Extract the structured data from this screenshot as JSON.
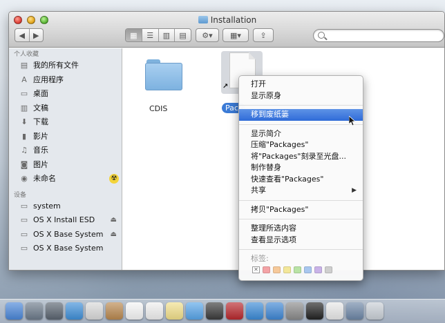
{
  "window": {
    "title": "Installation"
  },
  "sidebar": {
    "favorites_header": "个人收藏",
    "favorites": [
      {
        "label": "我的所有文件",
        "icon": "all-files-icon",
        "glyph": "▤"
      },
      {
        "label": "应用程序",
        "icon": "applications-icon",
        "glyph": "A"
      },
      {
        "label": "桌面",
        "icon": "desktop-icon",
        "glyph": "▭"
      },
      {
        "label": "文稿",
        "icon": "documents-icon",
        "glyph": "▥"
      },
      {
        "label": "下载",
        "icon": "downloads-icon",
        "glyph": "⬇"
      },
      {
        "label": "影片",
        "icon": "movies-icon",
        "glyph": "▮"
      },
      {
        "label": "音乐",
        "icon": "music-icon",
        "glyph": "♫"
      },
      {
        "label": "图片",
        "icon": "pictures-icon",
        "glyph": "◙"
      },
      {
        "label": "未命名",
        "icon": "radioactive-icon",
        "glyph": "☢"
      }
    ],
    "devices_header": "设备",
    "devices": [
      {
        "label": "system",
        "icon": "disk-icon",
        "glyph": "▭"
      },
      {
        "label": "OS X Install ESD",
        "icon": "disk-icon",
        "glyph": "▭"
      },
      {
        "label": "OS X Base System",
        "icon": "disk-icon",
        "glyph": "▭"
      },
      {
        "label": "OS X Base System",
        "icon": "disk-icon",
        "glyph": "▭"
      }
    ]
  },
  "content": {
    "folder_label": "CDIS",
    "selected_item_label": "Packages"
  },
  "context_menu": {
    "group1": [
      "打开",
      "显示原身"
    ],
    "highlighted": "移到废纸篓",
    "group2": [
      "显示简介",
      "压缩\"Packages\"",
      "将\"Packages\"刻录至光盘...",
      "制作替身",
      "快速查看\"Packages\""
    ],
    "share": "共享",
    "group3": [
      "拷贝\"Packages\""
    ],
    "group4": [
      "整理所选内容",
      "查看显示选项"
    ],
    "tags_label": "标签:",
    "tag_colors": [
      "#f4a3a6",
      "#f6c99a",
      "#f3e79a",
      "#b9e3a5",
      "#a8c7ef",
      "#c9b3e8",
      "#cfcfcf"
    ]
  },
  "dock": {
    "apps": [
      {
        "icon": "finder-icon",
        "color": "#4a86d8"
      },
      {
        "icon": "launchpad-icon",
        "color": "#6c7a8a"
      },
      {
        "icon": "mission-control-icon",
        "color": "#5a6470"
      },
      {
        "icon": "safari-icon",
        "color": "#3f8fd8"
      },
      {
        "icon": "mail-icon",
        "color": "#d9d9d9"
      },
      {
        "icon": "contacts-icon",
        "color": "#b9884f"
      },
      {
        "icon": "calendar-icon",
        "color": "#f5f5f5"
      },
      {
        "icon": "reminders-icon",
        "color": "#efefef"
      },
      {
        "icon": "notes-icon",
        "color": "#f1df8a"
      },
      {
        "icon": "messages-icon",
        "color": "#58a5e8"
      },
      {
        "icon": "facetime-icon",
        "color": "#3a3a3a"
      },
      {
        "icon": "photo-booth-icon",
        "color": "#b8282d"
      },
      {
        "icon": "itunes-icon",
        "color": "#3b8ad6"
      },
      {
        "icon": "app-store-icon",
        "color": "#3e86d4"
      },
      {
        "icon": "system-preferences-icon",
        "color": "#8a8a8a"
      },
      {
        "icon": "terminal-icon",
        "color": "#222222"
      },
      {
        "icon": "colorsync-icon",
        "color": "#e8e8e8"
      },
      {
        "icon": "downloads-stack-icon",
        "color": "#6d86a6"
      },
      {
        "icon": "trash-icon",
        "color": "#c9cfd6"
      }
    ]
  }
}
